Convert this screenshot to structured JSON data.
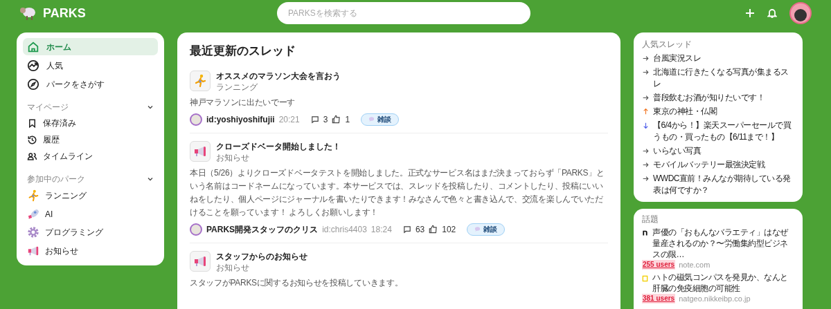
{
  "header": {
    "logo": "PARKS",
    "search": {
      "placeholder": "PARKSを検索する"
    }
  },
  "nav": [
    {
      "label": "ホーム",
      "kind": "home",
      "selected": true
    },
    {
      "label": "人気",
      "kind": "trending",
      "selected": false
    },
    {
      "label": "パークをさがす",
      "kind": "compass",
      "selected": false
    }
  ],
  "sections": [
    {
      "title": "マイページ",
      "expanded": true,
      "items": [
        {
          "label": "保存済み",
          "kind": "bookmark"
        },
        {
          "label": "履歴",
          "kind": "history"
        },
        {
          "label": "タイムライン",
          "kind": "people"
        }
      ]
    },
    {
      "title": "参加中のパーク",
      "expanded": true,
      "items": [
        {
          "label": "ランニング",
          "kind": "runner"
        },
        {
          "label": "AI",
          "kind": "rocket"
        },
        {
          "label": "プログラミング",
          "kind": "gear"
        },
        {
          "label": "お知らせ",
          "kind": "megaphone"
        }
      ]
    }
  ],
  "feed": {
    "title": "最近更新のスレッド",
    "threads": [
      {
        "kind": "runner",
        "title": "オススメのマラソン大会を言おう",
        "park": "ランニング",
        "body": "神戸マラソンに出たいでーす",
        "author": "id:yoshiyoshifujii",
        "time": "20:21",
        "comments": "3",
        "likes": "1",
        "tag": "雑談"
      },
      {
        "kind": "megaphone",
        "title": "クローズドベータ開始しました！",
        "park": "お知らせ",
        "body": "本日（5/26）よりクローズドベータテストを開始しました。正式なサービス名はまだ決まっておらず「PARKS」という名前はコードネームになっています。本サービスでは、スレッドを投稿したり、コメントしたり、投稿にいいねをしたり、個人ページにジャーナルを書いたりできます！みなさんで色々と書き込んで、交流を楽しんでいただけることを願っています！ よろしくお願いします！",
        "author": "PARKS開発スタッフのクリス",
        "handle": "id:chris4403",
        "time": "18:24",
        "comments": "63",
        "likes": "102",
        "tag": "雑談"
      },
      {
        "kind": "megaphone",
        "title": "スタッフからのお知らせ",
        "park": "お知らせ",
        "body": "スタッフがPARKSに関するお知らせを投稿していきます。"
      }
    ]
  },
  "popular": {
    "title": "人気スレッド",
    "items": [
      {
        "kind": "flat",
        "label": "台風実況スレ"
      },
      {
        "kind": "flat",
        "label": "北海道に行きたくなる写真が集まるスレ"
      },
      {
        "kind": "flat",
        "label": "普段飲むお酒が知りたいです！"
      },
      {
        "kind": "up",
        "label": "東京の神社・仏閣"
      },
      {
        "kind": "down",
        "label": "【6/4から！】楽天スーパーセールで買うもの・買ったもの【6/11まで！】"
      },
      {
        "kind": "flat",
        "label": "いらない写真"
      },
      {
        "kind": "flat",
        "label": "モバイルバッテリー最強決定戦"
      },
      {
        "kind": "flat",
        "label": "WWDC直前！みんなが期待している発表は何ですか？"
      }
    ]
  },
  "topics": {
    "title": "話題",
    "items": [
      {
        "kind": "note",
        "title": "声優の「おもんなバラエティ」はなぜ量産されるのか？〜労働集約型ビジネスの限…",
        "users": "255 users",
        "domain": "note.com"
      },
      {
        "kind": "natgeo",
        "title": "ハトの磁気コンパスを発見か、なんと肝臓の免疫細胞の可能性",
        "users": "381 users",
        "domain": "natgeo.nikkeibp.co.jp"
      }
    ]
  }
}
